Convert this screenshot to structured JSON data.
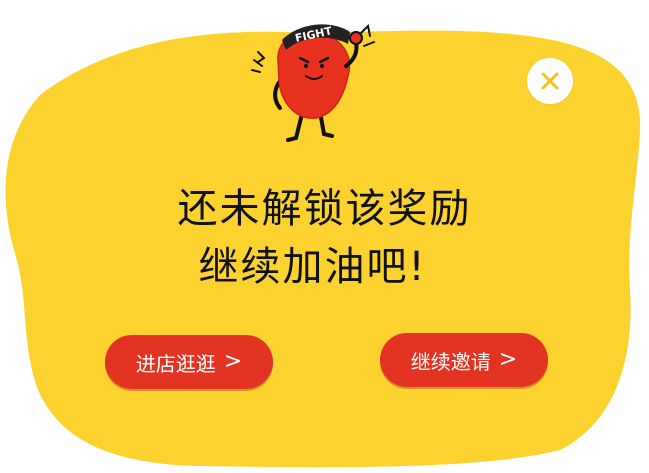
{
  "colors": {
    "background_blob": "#fcd22f",
    "button": "#e33322",
    "button_text": "#ffffff",
    "close_bg": "#ffffff",
    "close_x": "#f2c21c",
    "message_text": "#111111",
    "mascot_body": "#e8321f"
  },
  "mascot": {
    "headband_text": "FIGHT"
  },
  "message": {
    "line1": "还未解锁该奖励",
    "line2": "继续加油吧!"
  },
  "buttons": {
    "store_label": "进店逛逛",
    "invite_label": "继续邀请",
    "chevron": ">"
  },
  "icons": {
    "close": "close-icon",
    "chevron": "chevron-right-icon"
  }
}
